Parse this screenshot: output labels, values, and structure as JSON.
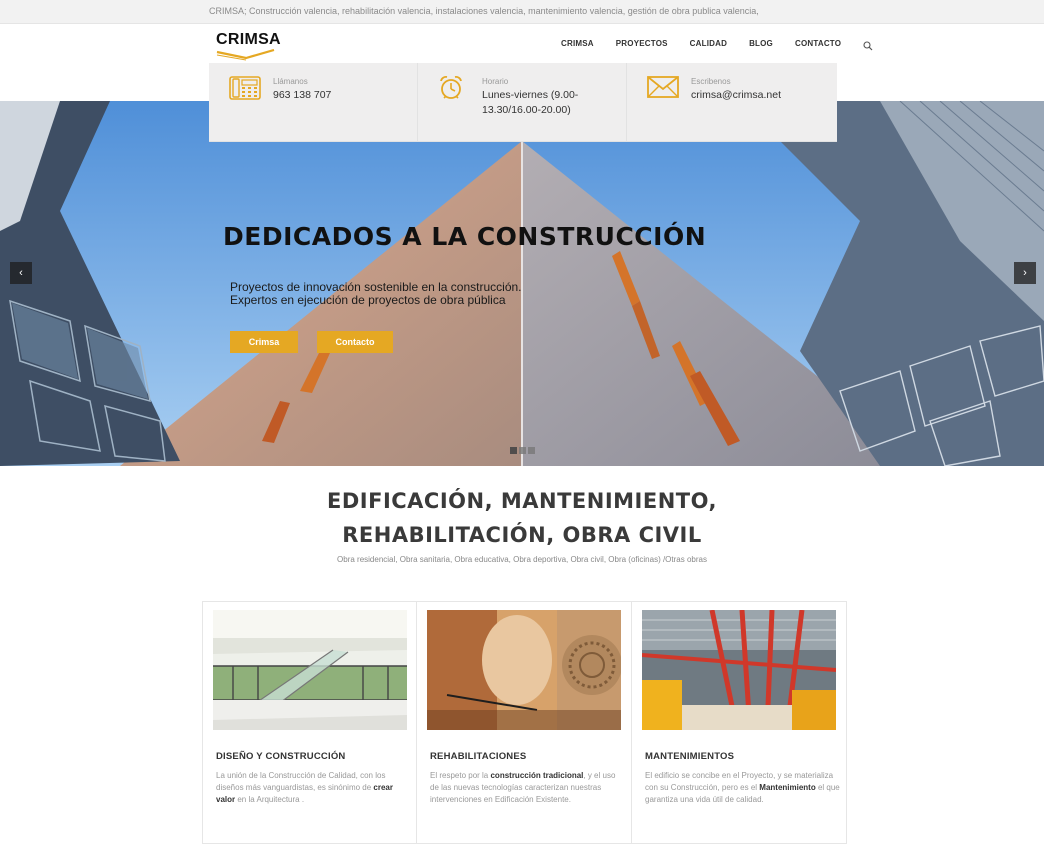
{
  "topbar": {
    "tagline": "CRIMSA; Construcción valencia, rehabilitación valencia, instalaciones valencia, mantenimiento valencia, gestión de obra publica valencia,"
  },
  "logo": {
    "text": "CRIMSA"
  },
  "nav": {
    "items": [
      "CRIMSA",
      "PROYECTOS",
      "CALIDAD",
      "BLOG",
      "CONTACTO"
    ],
    "search_icon": "search-icon"
  },
  "info": [
    {
      "icon": "phone-icon",
      "label": "Llámanos",
      "value": "963 138 707"
    },
    {
      "icon": "alarm-clock-icon",
      "label": "Horario",
      "value": "Lunes-viernes (9.00-13.30/16.00-20.00)"
    },
    {
      "icon": "envelope-icon",
      "label": "Escribenos",
      "value": "crimsa@crimsa.net"
    }
  ],
  "hero": {
    "title": "DEDICADOS A LA CONSTRUCCIÓN",
    "subtitle_line1": "Proyectos de innovación sostenible en la construcción.",
    "subtitle_line2": "Expertos en ejecución de proyectos de obra pública",
    "button1": "Crimsa",
    "button2": "Contacto",
    "prev_glyph": "‹",
    "next_glyph": "›",
    "slides": 3,
    "active_slide": 1
  },
  "section": {
    "title_line1": "EDIFICACIÓN, MANTENIMIENTO,",
    "title_line2": "REHABILITACIÓN, OBRA CIVIL",
    "subtitle": "Obra residencial, Obra sanitaria, Obra educativa, Obra deportiva, Obra civil, Obra (oficinas) /Otras obras"
  },
  "cards": [
    {
      "title": "DISEÑO Y CONSTRUCCIÓN",
      "text_before": "La unión de la Construcción de Calidad, con los diseños más vanguardistas, es sinónimo de ",
      "text_bold": "crear valor",
      "text_after": " en la Arquitectura ."
    },
    {
      "title": "REHABILITACIONES",
      "text_before": "El respeto por la ",
      "text_bold": "construcción tradicional",
      "text_after": ", y el uso de las nuevas tecnologías caracterizan nuestras intervenciones en Edificación Existente."
    },
    {
      "title": "MANTENIMIENTOS",
      "text_before": "El edificio se concibe en el Proyecto, y se materializa con su Construcción, pero es el ",
      "text_bold": "Mantenimiento",
      "text_after": " el que garantiza una vida útil de calidad."
    }
  ],
  "colors": {
    "accent": "#e5a823",
    "topbar_bg": "#f2f2f2",
    "info_bg": "#efeeee",
    "heading": "#3a3a3a"
  }
}
